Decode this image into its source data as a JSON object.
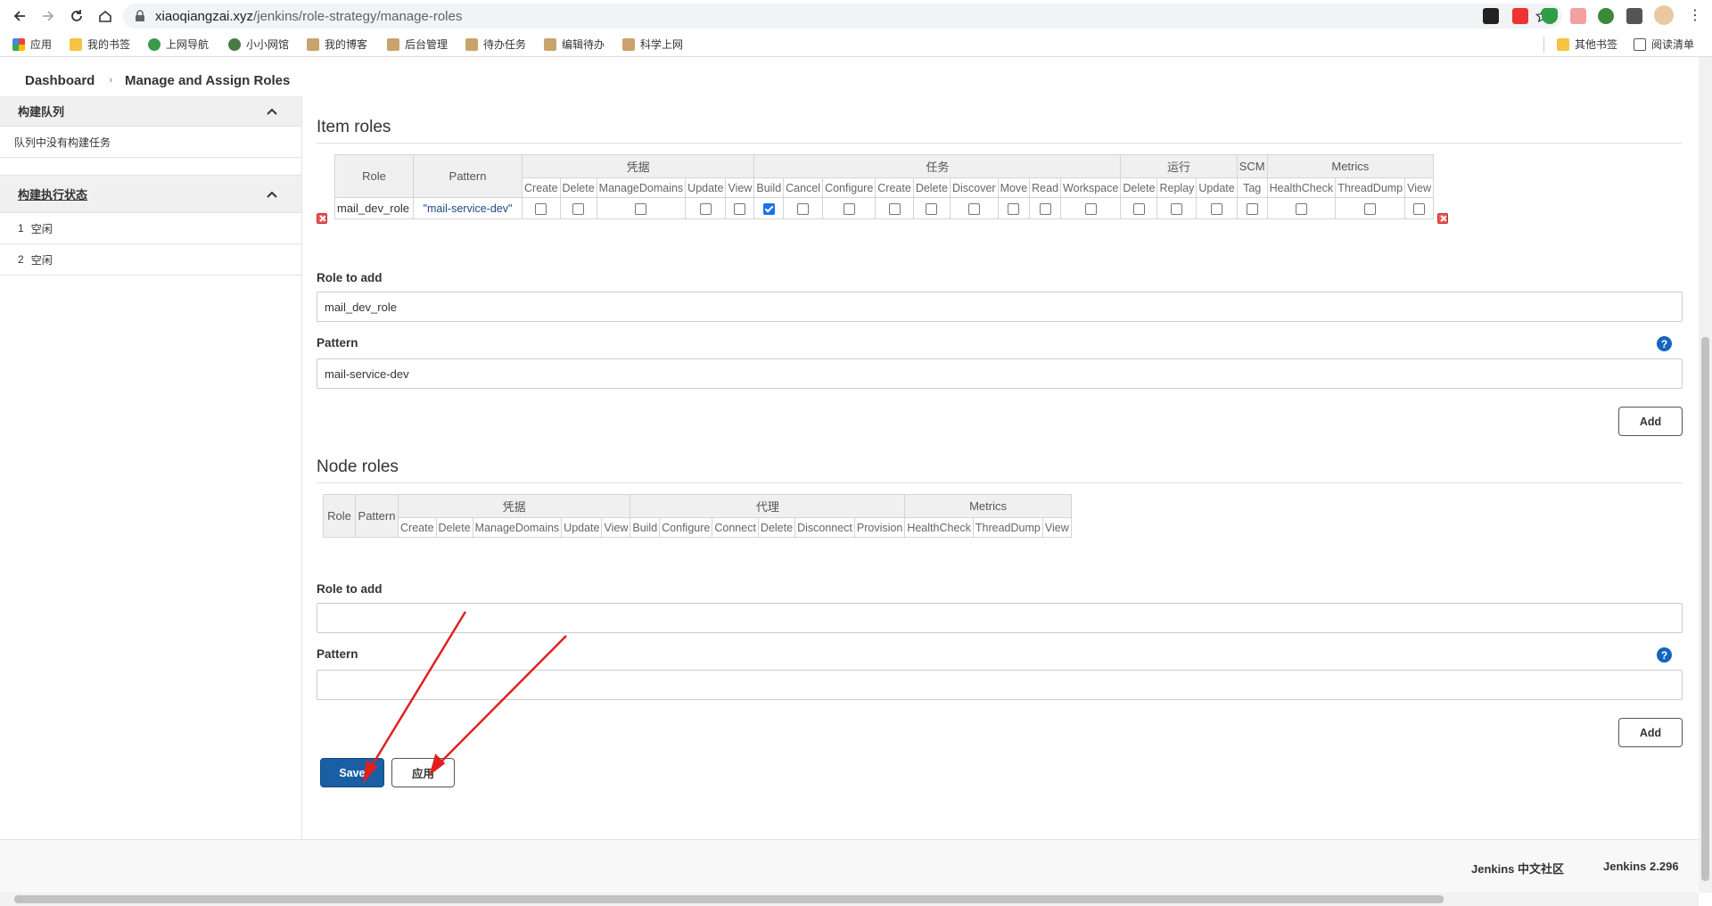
{
  "browser": {
    "url_host": "xiaoqiangzai.xyz",
    "url_path": "/jenkins/role-strategy/manage-roles",
    "bookmarks": [
      "应用",
      "我的书签",
      "上网导航",
      "小小网馆",
      "我的博客",
      "后台管理",
      "待办任务",
      "编辑待办",
      "科学上网"
    ],
    "bookmarks_right": [
      "其他书签",
      "阅读清单"
    ]
  },
  "breadcrumb": {
    "dashboard": "Dashboard",
    "current": "Manage and Assign Roles"
  },
  "sidepanel": {
    "queue_title": "构建队列",
    "queue_empty": "队列中没有构建任务",
    "executors_title": "构建执行状态",
    "executors": [
      {
        "num": "1",
        "status": "空闲"
      },
      {
        "num": "2",
        "status": "空闲"
      }
    ]
  },
  "item_roles": {
    "title": "Item roles",
    "role_header": "Role",
    "pattern_header": "Pattern",
    "groups": [
      {
        "name": "凭据",
        "perms": [
          "Create",
          "Delete",
          "ManageDomains",
          "Update",
          "View"
        ]
      },
      {
        "name": "任务",
        "perms": [
          "Build",
          "Cancel",
          "Configure",
          "Create",
          "Delete",
          "Discover",
          "Move",
          "Read",
          "Workspace"
        ]
      },
      {
        "name": "运行",
        "perms": [
          "Delete",
          "Replay",
          "Update"
        ]
      },
      {
        "name": "SCM",
        "perms": [
          "Tag"
        ]
      },
      {
        "name": "Metrics",
        "perms": [
          "HealthCheck",
          "ThreadDump",
          "View"
        ]
      }
    ],
    "rows": [
      {
        "role": "mail_dev_role",
        "pattern": "\"mail-service-dev\"",
        "checked": [
          false,
          false,
          false,
          false,
          false,
          true,
          false,
          false,
          false,
          false,
          false,
          false,
          false,
          false,
          false,
          false,
          false,
          false,
          false,
          false,
          false
        ]
      }
    ],
    "role_to_add_label": "Role to add",
    "role_to_add_value": "mail_dev_role",
    "pattern_label": "Pattern",
    "pattern_value": "mail-service-dev",
    "add_label": "Add"
  },
  "node_roles": {
    "title": "Node roles",
    "role_header": "Role",
    "pattern_header": "Pattern",
    "groups": [
      {
        "name": "凭据",
        "perms": [
          "Create",
          "Delete",
          "ManageDomains",
          "Update",
          "View"
        ]
      },
      {
        "name": "代理",
        "perms": [
          "Build",
          "Configure",
          "Connect",
          "Delete",
          "Disconnect",
          "Provision"
        ]
      },
      {
        "name": "Metrics",
        "perms": [
          "HealthCheck",
          "ThreadDump",
          "View"
        ]
      }
    ],
    "role_to_add_label": "Role to add",
    "role_to_add_value": "",
    "pattern_label": "Pattern",
    "pattern_value": "",
    "add_label": "Add"
  },
  "help_glyph": "?",
  "actions": {
    "save": "Save",
    "apply": "应用"
  },
  "footer": {
    "community": "Jenkins 中文社区",
    "version": "Jenkins 2.296"
  },
  "colors": {
    "primary_button": "#1a5fa3",
    "arrow": "#e02020",
    "checkbox_checked": "#1a73e8"
  }
}
